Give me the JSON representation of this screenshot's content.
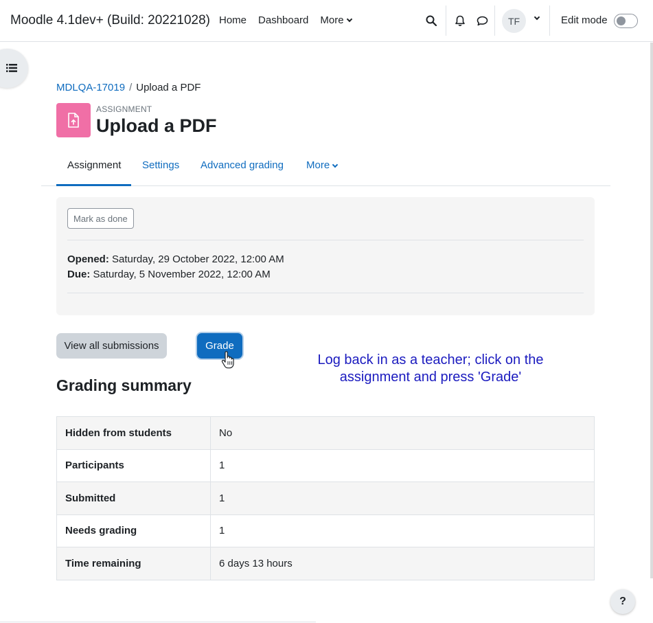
{
  "navbar": {
    "brand": "Moodle 4.1dev+ (Build: 20221028)",
    "links": [
      "Home",
      "Dashboard"
    ],
    "more_label": "More",
    "avatar_initials": "TF",
    "edit_mode_label": "Edit mode",
    "edit_mode_on": false
  },
  "breadcrumb": {
    "course": "MDLQA-17019",
    "current": "Upload a PDF"
  },
  "header": {
    "pretitle": "ASSIGNMENT",
    "title": "Upload a PDF",
    "icon_color": "#f06fa6"
  },
  "tabs": {
    "items": [
      "Assignment",
      "Settings",
      "Advanced grading"
    ],
    "more_label": "More",
    "active": "Assignment"
  },
  "activity": {
    "mark_done_label": "Mark as done",
    "opened_label": "Opened:",
    "opened_value": "Saturday, 29 October 2022, 12:00 AM",
    "due_label": "Due:",
    "due_value": "Saturday, 5 November 2022, 12:00 AM"
  },
  "actions": {
    "view_all_label": "View all submissions",
    "grade_label": "Grade"
  },
  "annotation": "Log back in as a teacher; click on the assignment and press 'Grade'",
  "grading_summary": {
    "title": "Grading summary",
    "rows": [
      {
        "label": "Hidden from students",
        "value": "No"
      },
      {
        "label": "Participants",
        "value": "1"
      },
      {
        "label": "Submitted",
        "value": "1"
      },
      {
        "label": "Needs grading",
        "value": "1"
      },
      {
        "label": "Time remaining",
        "value": "6 days 13 hours"
      }
    ]
  },
  "help_label": "?",
  "colors": {
    "primary": "#0f6cbf",
    "annotation_text": "#1b1bbf"
  }
}
